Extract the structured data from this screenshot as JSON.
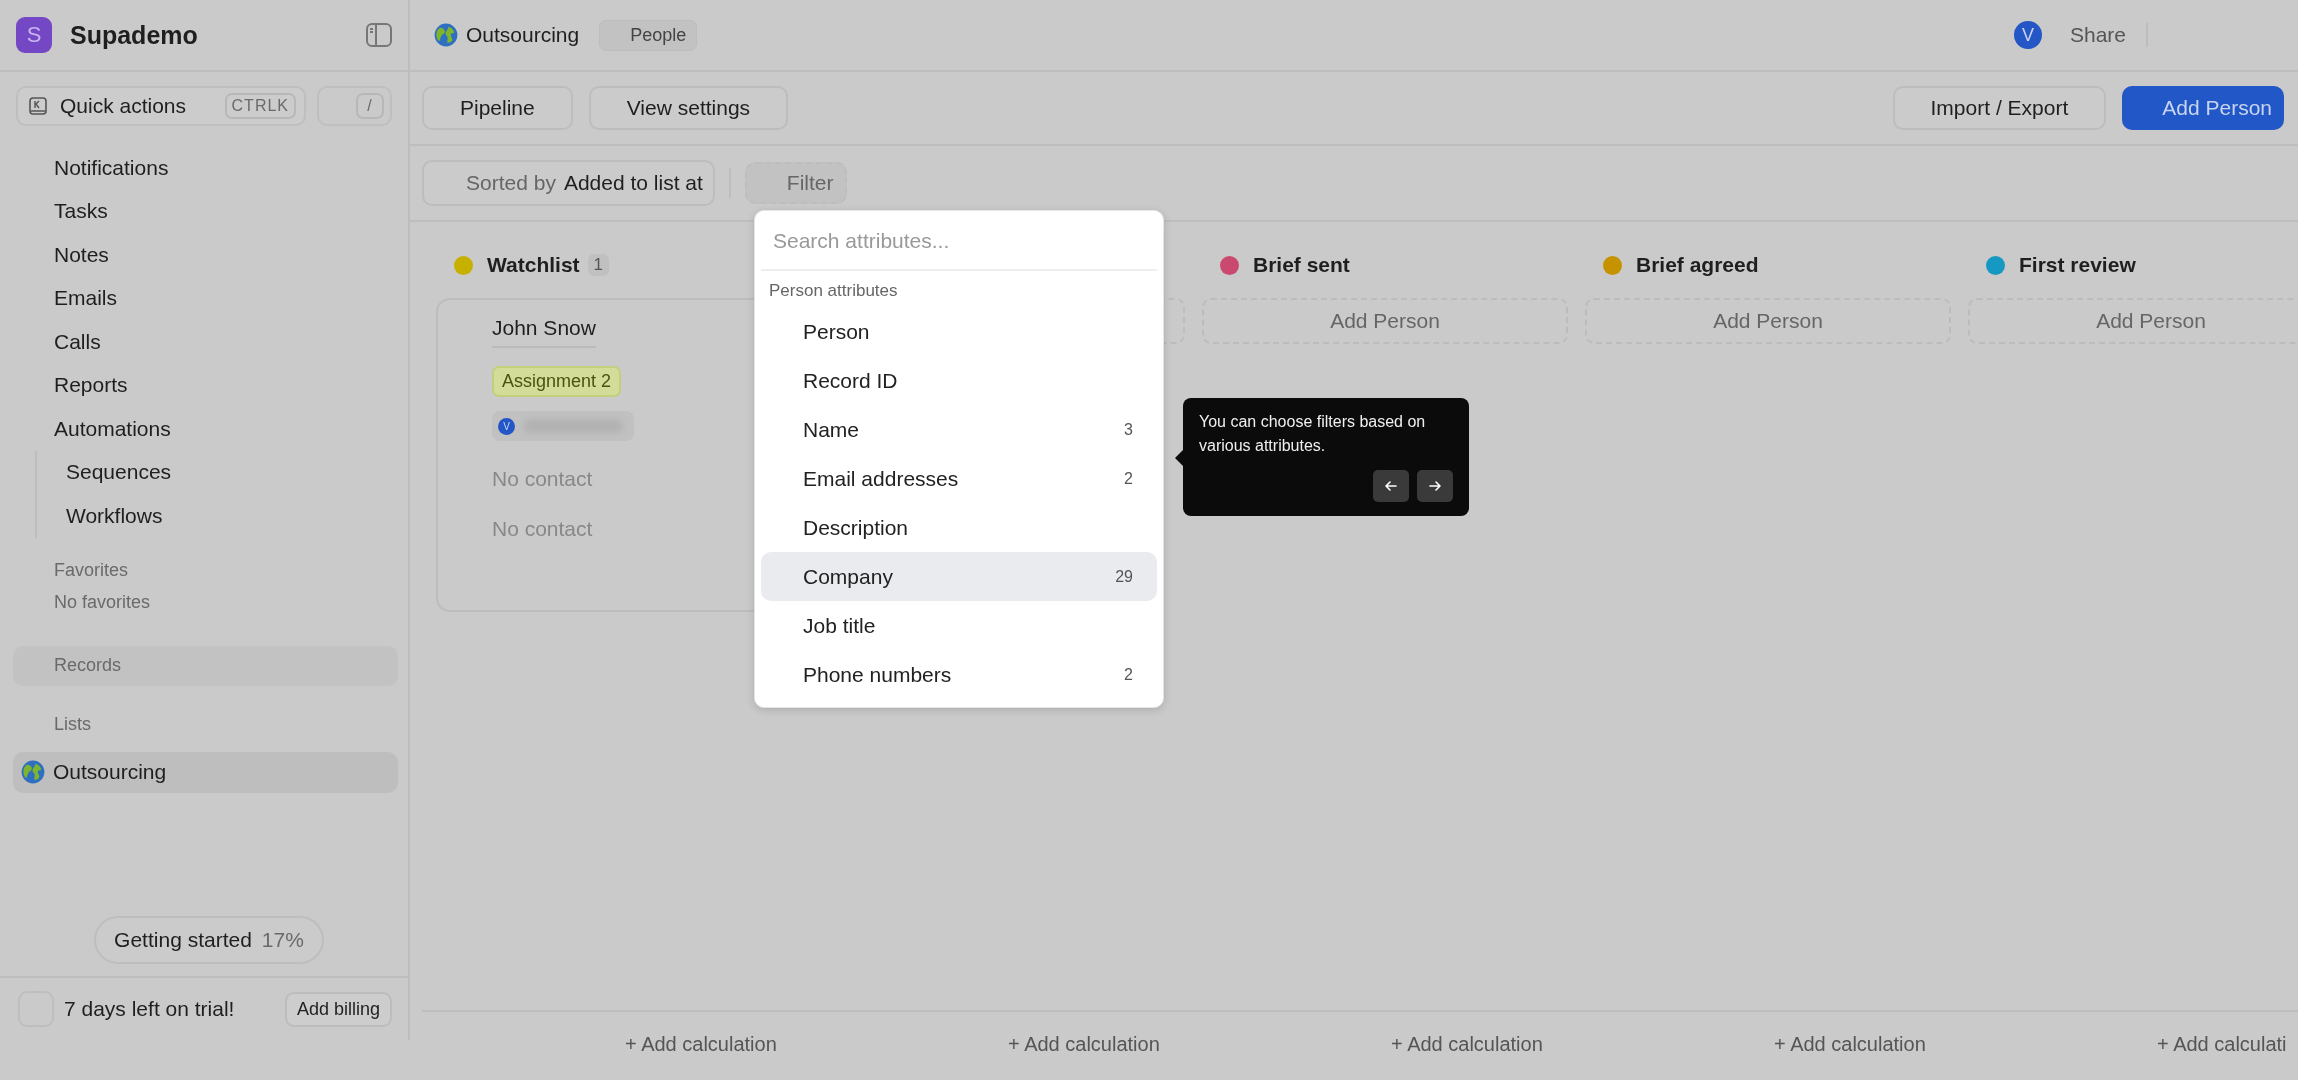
{
  "sidebar": {
    "workspace": {
      "initial": "S",
      "name": "Supademo"
    },
    "quick_actions": {
      "label": "Quick actions",
      "shortcut": "CTRLK",
      "slash": "/"
    },
    "nav": [
      {
        "label": "Notifications"
      },
      {
        "label": "Tasks"
      },
      {
        "label": "Notes"
      },
      {
        "label": "Emails"
      },
      {
        "label": "Calls"
      },
      {
        "label": "Reports"
      },
      {
        "label": "Automations",
        "children": [
          {
            "label": "Sequences"
          },
          {
            "label": "Workflows"
          }
        ]
      }
    ],
    "favorites": {
      "heading": "Favorites",
      "empty": "No favorites"
    },
    "records": {
      "label": "Records"
    },
    "lists": {
      "heading": "Lists",
      "items": [
        {
          "label": "Outsourcing",
          "selected": true
        }
      ]
    },
    "getting_started": {
      "label": "Getting started",
      "progress": "17%"
    },
    "trial": {
      "text": "7 days left on trial!",
      "button": "Add billing"
    }
  },
  "header": {
    "list": "Outsourcing",
    "object": "People",
    "avatar": "V",
    "share": "Share"
  },
  "toolbar": {
    "views": [
      "Pipeline",
      "View settings"
    ],
    "import_export": "Import / Export",
    "add": "Add Person"
  },
  "sort": {
    "label": "Sorted by",
    "value": "Added to list at"
  },
  "filter": "Filter",
  "columns": [
    {
      "name": "Watchlist",
      "color": "#c8b000",
      "count": "1",
      "kind": "cards"
    },
    {
      "kind": "hidden"
    },
    {
      "name": "Brief sent",
      "color": "#c94a6e",
      "kind": "empty",
      "add": "Add Person"
    },
    {
      "name": "Brief agreed",
      "color": "#c79200",
      "kind": "empty",
      "add": "Add Person"
    },
    {
      "name": "First review",
      "color": "#1599c2",
      "kind": "empty",
      "add": "Add Person"
    }
  ],
  "card": {
    "name": "John Snow",
    "tag": "Assignment 2",
    "owner_initial": "V",
    "fields": [
      "No contact",
      "No contact"
    ]
  },
  "calculations": [
    "+ Add calculation",
    "+ Add calculation",
    "+ Add calculation",
    "+ Add calculation",
    "+ Add calculati"
  ],
  "dropdown": {
    "placeholder": "Search attributes...",
    "group": "Person attributes",
    "items": [
      {
        "label": "Person",
        "selected": false
      },
      {
        "label": "Record ID",
        "selected": false
      },
      {
        "label": "Name",
        "count": "3",
        "selected": false
      },
      {
        "label": "Email addresses",
        "count": "2",
        "selected": false
      },
      {
        "label": "Description",
        "selected": false
      },
      {
        "label": "Company",
        "count": "29",
        "selected": true
      },
      {
        "label": "Job title",
        "selected": false
      },
      {
        "label": "Phone numbers",
        "count": "2",
        "selected": false
      }
    ]
  },
  "tooltip": {
    "text": "You can choose filters based on various attributes."
  }
}
